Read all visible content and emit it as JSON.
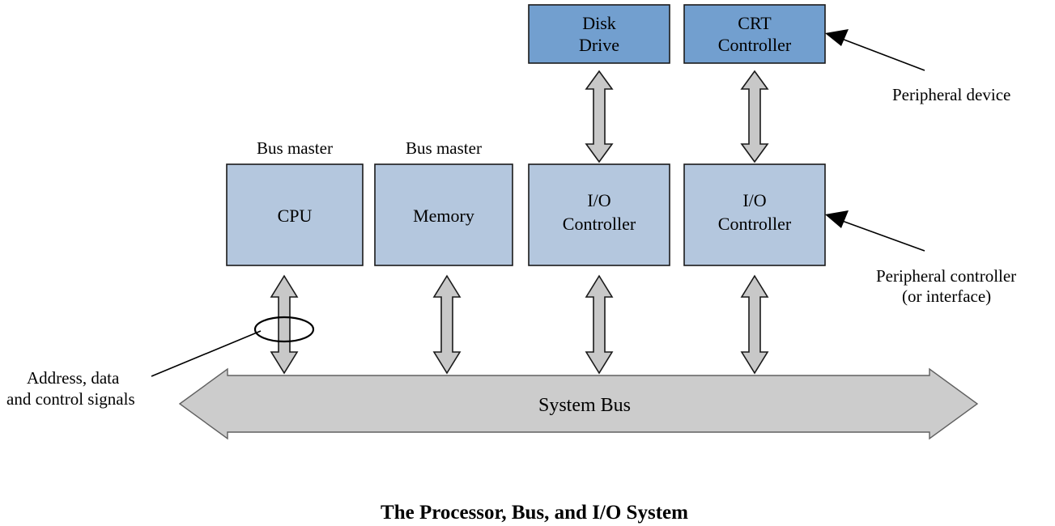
{
  "diagram": {
    "caption": "The Processor, Bus, and I/O System",
    "colors": {
      "peripheral_device_fill": "#729FCF",
      "controller_fill": "#B4C7DE",
      "arrow_fill": "#C8C8C8",
      "bus_fill": "#CCCCCC",
      "outline": "#1A1A1A",
      "background": "#FFFFFF"
    },
    "top_row": [
      {
        "id": "disk-drive",
        "line1": "Disk",
        "line2": "Drive"
      },
      {
        "id": "crt-controller",
        "line1": "CRT",
        "line2": "Controller"
      }
    ],
    "main_row": [
      {
        "id": "cpu",
        "line1": "CPU",
        "line2": ""
      },
      {
        "id": "memory",
        "line1": "Memory",
        "line2": ""
      },
      {
        "id": "io-controller-1",
        "line1": "I/O",
        "line2": "Controller"
      },
      {
        "id": "io-controller-2",
        "line1": "I/O",
        "line2": "Controller"
      }
    ],
    "bus_master_labels": [
      {
        "id": "bus-master-cpu",
        "text": "Bus master"
      },
      {
        "id": "bus-master-memory",
        "text": "Bus master"
      }
    ],
    "bus": {
      "label": "System Bus"
    },
    "annotations": {
      "peripheral_device": "Peripheral device",
      "peripheral_controller_line1": "Peripheral controller",
      "peripheral_controller_line2": "(or interface)",
      "signals_line1": "Address, data",
      "signals_line2": "and control signals"
    }
  }
}
